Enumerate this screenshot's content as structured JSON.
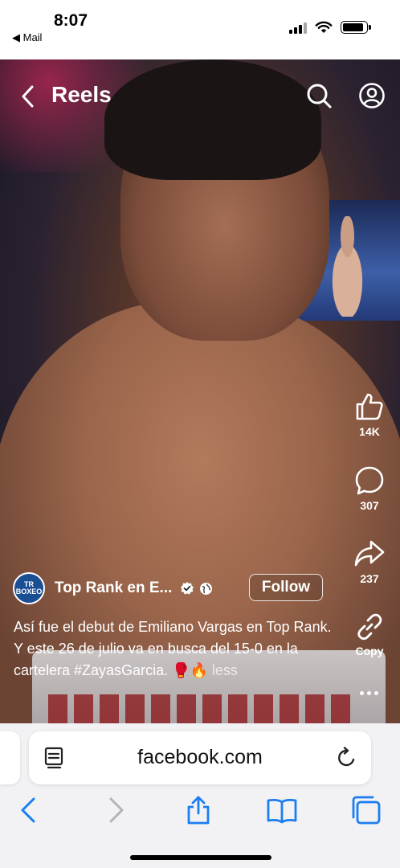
{
  "status_bar": {
    "time": "8:07",
    "back_app": "◀ Mail",
    "battery_level": 0.9
  },
  "header": {
    "title": "Reels",
    "icons": [
      "back-chevron-icon",
      "search-icon",
      "profile-icon"
    ]
  },
  "actions": {
    "like_count": "14K",
    "comment_count": "307",
    "share_count": "237",
    "copy_label": "Copy"
  },
  "post": {
    "avatar_text_top": "TR",
    "avatar_text_bottom": "BOXEO",
    "author": "Top Rank en E...",
    "follow_label": "Follow",
    "caption": "Así fue el debut de Emiliano Vargas en Top Rank. Y este 26 de julio va en busca del 15-0 en la cartelera #ZayasGarcia. 🥊🔥",
    "less_label": "less"
  },
  "browser": {
    "url": "facebook.com",
    "icons": [
      "reader-icon",
      "reload-icon",
      "back-icon",
      "forward-icon",
      "share-icon",
      "bookmarks-icon",
      "tabs-icon"
    ]
  },
  "colors": {
    "accent_blue": "#1c7ef2",
    "video_bg": "#14121e"
  }
}
